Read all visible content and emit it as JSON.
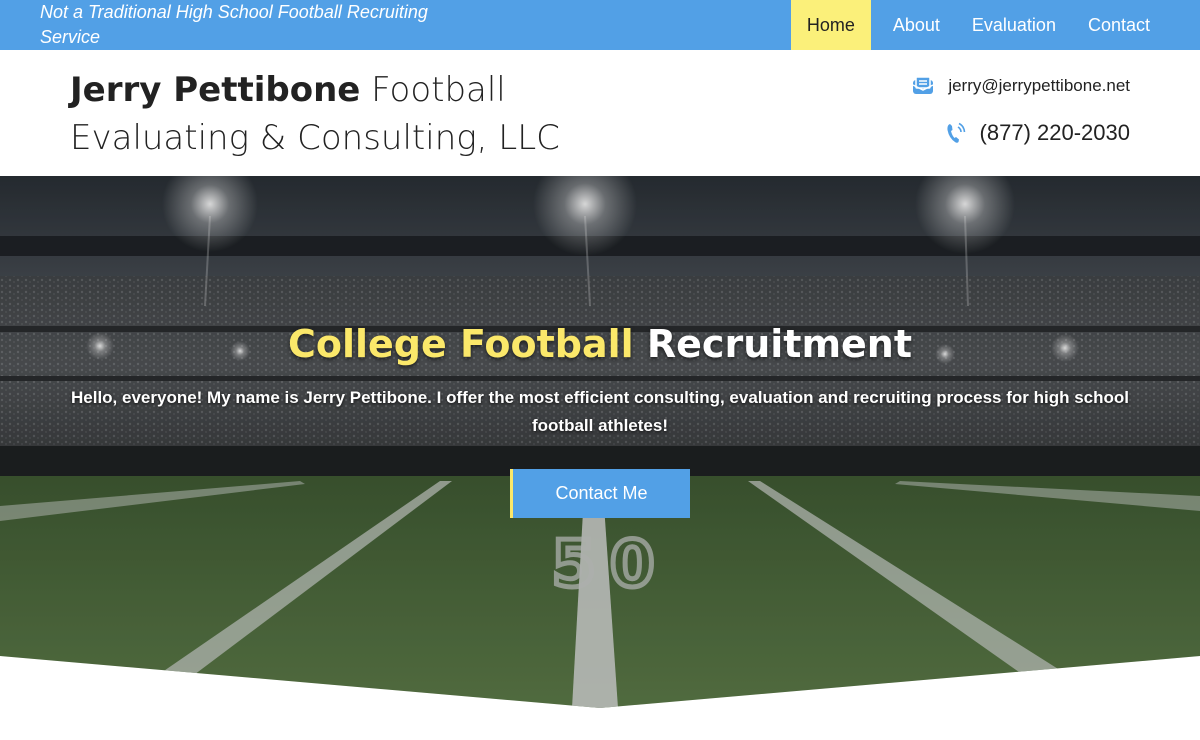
{
  "topbar": {
    "tagline": "Not a Traditional High School Football Recruiting Service",
    "nav": [
      {
        "label": "Home",
        "active": true
      },
      {
        "label": "About",
        "active": false
      },
      {
        "label": "Evaluation",
        "active": false
      },
      {
        "label": "Contact",
        "active": false
      }
    ]
  },
  "header": {
    "brand_bold": "Jerry Pettibone",
    "brand_rest": " Football Evaluating & Consulting, LLC",
    "email": "jerry@jerrypettibone.net",
    "email_icon": "envelope-icon",
    "phone": "(877) 220-2030",
    "phone_icon": "phone-icon"
  },
  "hero": {
    "title_highlight": "College Football",
    "title_rest": " Recruitment",
    "text": "Hello, everyone! My name is Jerry Pettibone. I offer the most efficient consulting, evaluation and recruiting process for high school football athletes!",
    "cta_label": "Contact Me",
    "field_number": "50"
  },
  "colors": {
    "accent_blue": "#52a0e6",
    "accent_yellow": "#fbe86a"
  }
}
